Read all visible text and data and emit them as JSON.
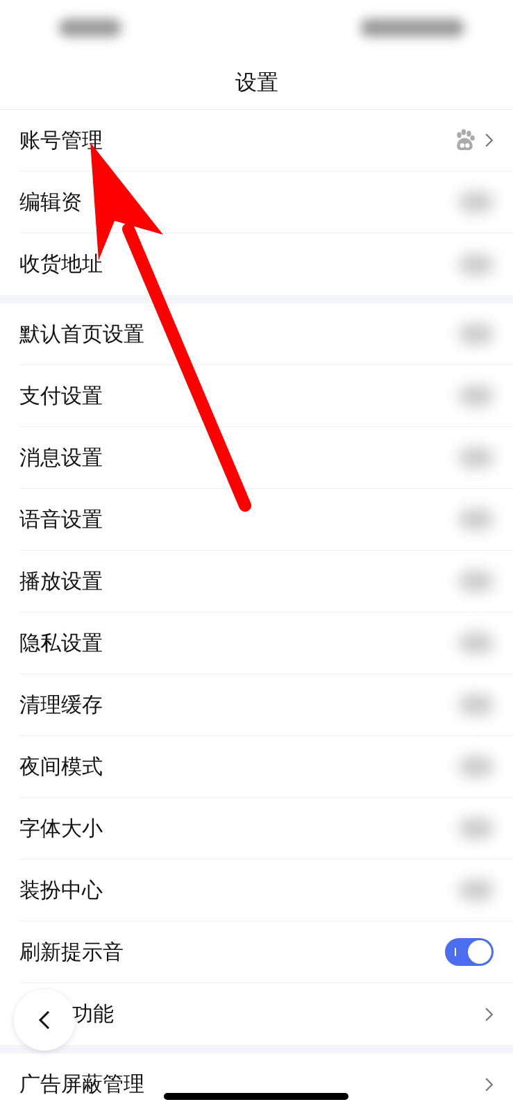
{
  "header": {
    "title": "设置"
  },
  "groups": [
    {
      "items": [
        {
          "label": "账号管理",
          "kind": "account"
        },
        {
          "label": "编辑资",
          "kind": "blurred"
        },
        {
          "label": "收货地址",
          "kind": "blurred"
        }
      ]
    },
    {
      "items": [
        {
          "label": "默认首页设置",
          "kind": "blurred"
        },
        {
          "label": "支付设置",
          "kind": "blurred"
        },
        {
          "label": "消息设置",
          "kind": "blurred"
        },
        {
          "label": "语音设置",
          "kind": "blurred"
        },
        {
          "label": "播放设置",
          "kind": "blurred"
        },
        {
          "label": "隐私设置",
          "kind": "blurred"
        },
        {
          "label": "清理缓存",
          "kind": "blurred"
        },
        {
          "label": "夜间模式",
          "kind": "blurred"
        },
        {
          "label": "字体大小",
          "kind": "blurred"
        },
        {
          "label": "装扮中心",
          "kind": "blurred"
        },
        {
          "label": "刷新提示音",
          "kind": "toggle",
          "on": true
        },
        {
          "label": "功能",
          "kind": "link"
        }
      ]
    },
    {
      "items": [
        {
          "label": "广告屏蔽管理",
          "kind": "link"
        }
      ]
    }
  ]
}
